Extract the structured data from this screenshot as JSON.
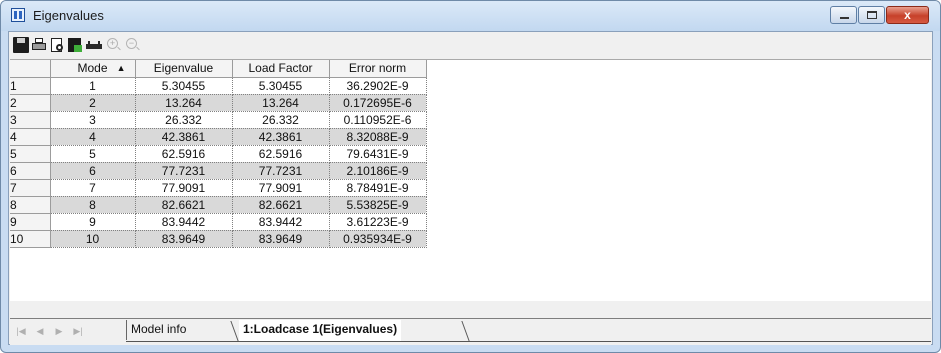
{
  "window": {
    "title": "Eigenvalues",
    "close_glyph": "x"
  },
  "toolbar": {
    "icons": [
      "save-icon",
      "print-icon",
      "print-preview-icon",
      "export-icon",
      "columns-icon",
      "zoom-in-icon",
      "zoom-out-icon"
    ]
  },
  "grid": {
    "columns": [
      "Mode",
      "Eigenvalue",
      "Load Factor",
      "Error norm"
    ],
    "sort_glyph": "▲",
    "rows": [
      {
        "num": "1",
        "mode": "1",
        "eigenvalue": "5.30455",
        "load_factor": "5.30455",
        "error_norm": "36.2902E-9"
      },
      {
        "num": "2",
        "mode": "2",
        "eigenvalue": "13.264",
        "load_factor": "13.264",
        "error_norm": "0.172695E-6"
      },
      {
        "num": "3",
        "mode": "3",
        "eigenvalue": "26.332",
        "load_factor": "26.332",
        "error_norm": "0.110952E-6"
      },
      {
        "num": "4",
        "mode": "4",
        "eigenvalue": "42.3861",
        "load_factor": "42.3861",
        "error_norm": "8.32088E-9"
      },
      {
        "num": "5",
        "mode": "5",
        "eigenvalue": "62.5916",
        "load_factor": "62.5916",
        "error_norm": "79.6431E-9"
      },
      {
        "num": "6",
        "mode": "6",
        "eigenvalue": "77.7231",
        "load_factor": "77.7231",
        "error_norm": "2.10186E-9"
      },
      {
        "num": "7",
        "mode": "7",
        "eigenvalue": "77.9091",
        "load_factor": "77.9091",
        "error_norm": "8.78491E-9"
      },
      {
        "num": "8",
        "mode": "8",
        "eigenvalue": "82.6621",
        "load_factor": "82.6621",
        "error_norm": "5.53825E-9"
      },
      {
        "num": "9",
        "mode": "9",
        "eigenvalue": "83.9442",
        "load_factor": "83.9442",
        "error_norm": "3.61223E-9"
      },
      {
        "num": "10",
        "mode": "10",
        "eigenvalue": "83.9649",
        "load_factor": "83.9649",
        "error_norm": "0.935934E-9"
      }
    ]
  },
  "tabs": {
    "items": [
      {
        "label": "Model info",
        "active": false
      },
      {
        "label": "1:Loadcase 1(Eigenvalues)",
        "active": true
      }
    ]
  },
  "colors": {
    "title_bar": "#c9dcf2",
    "alt_row": "#d9d9d9",
    "close_button": "#c7412a"
  }
}
